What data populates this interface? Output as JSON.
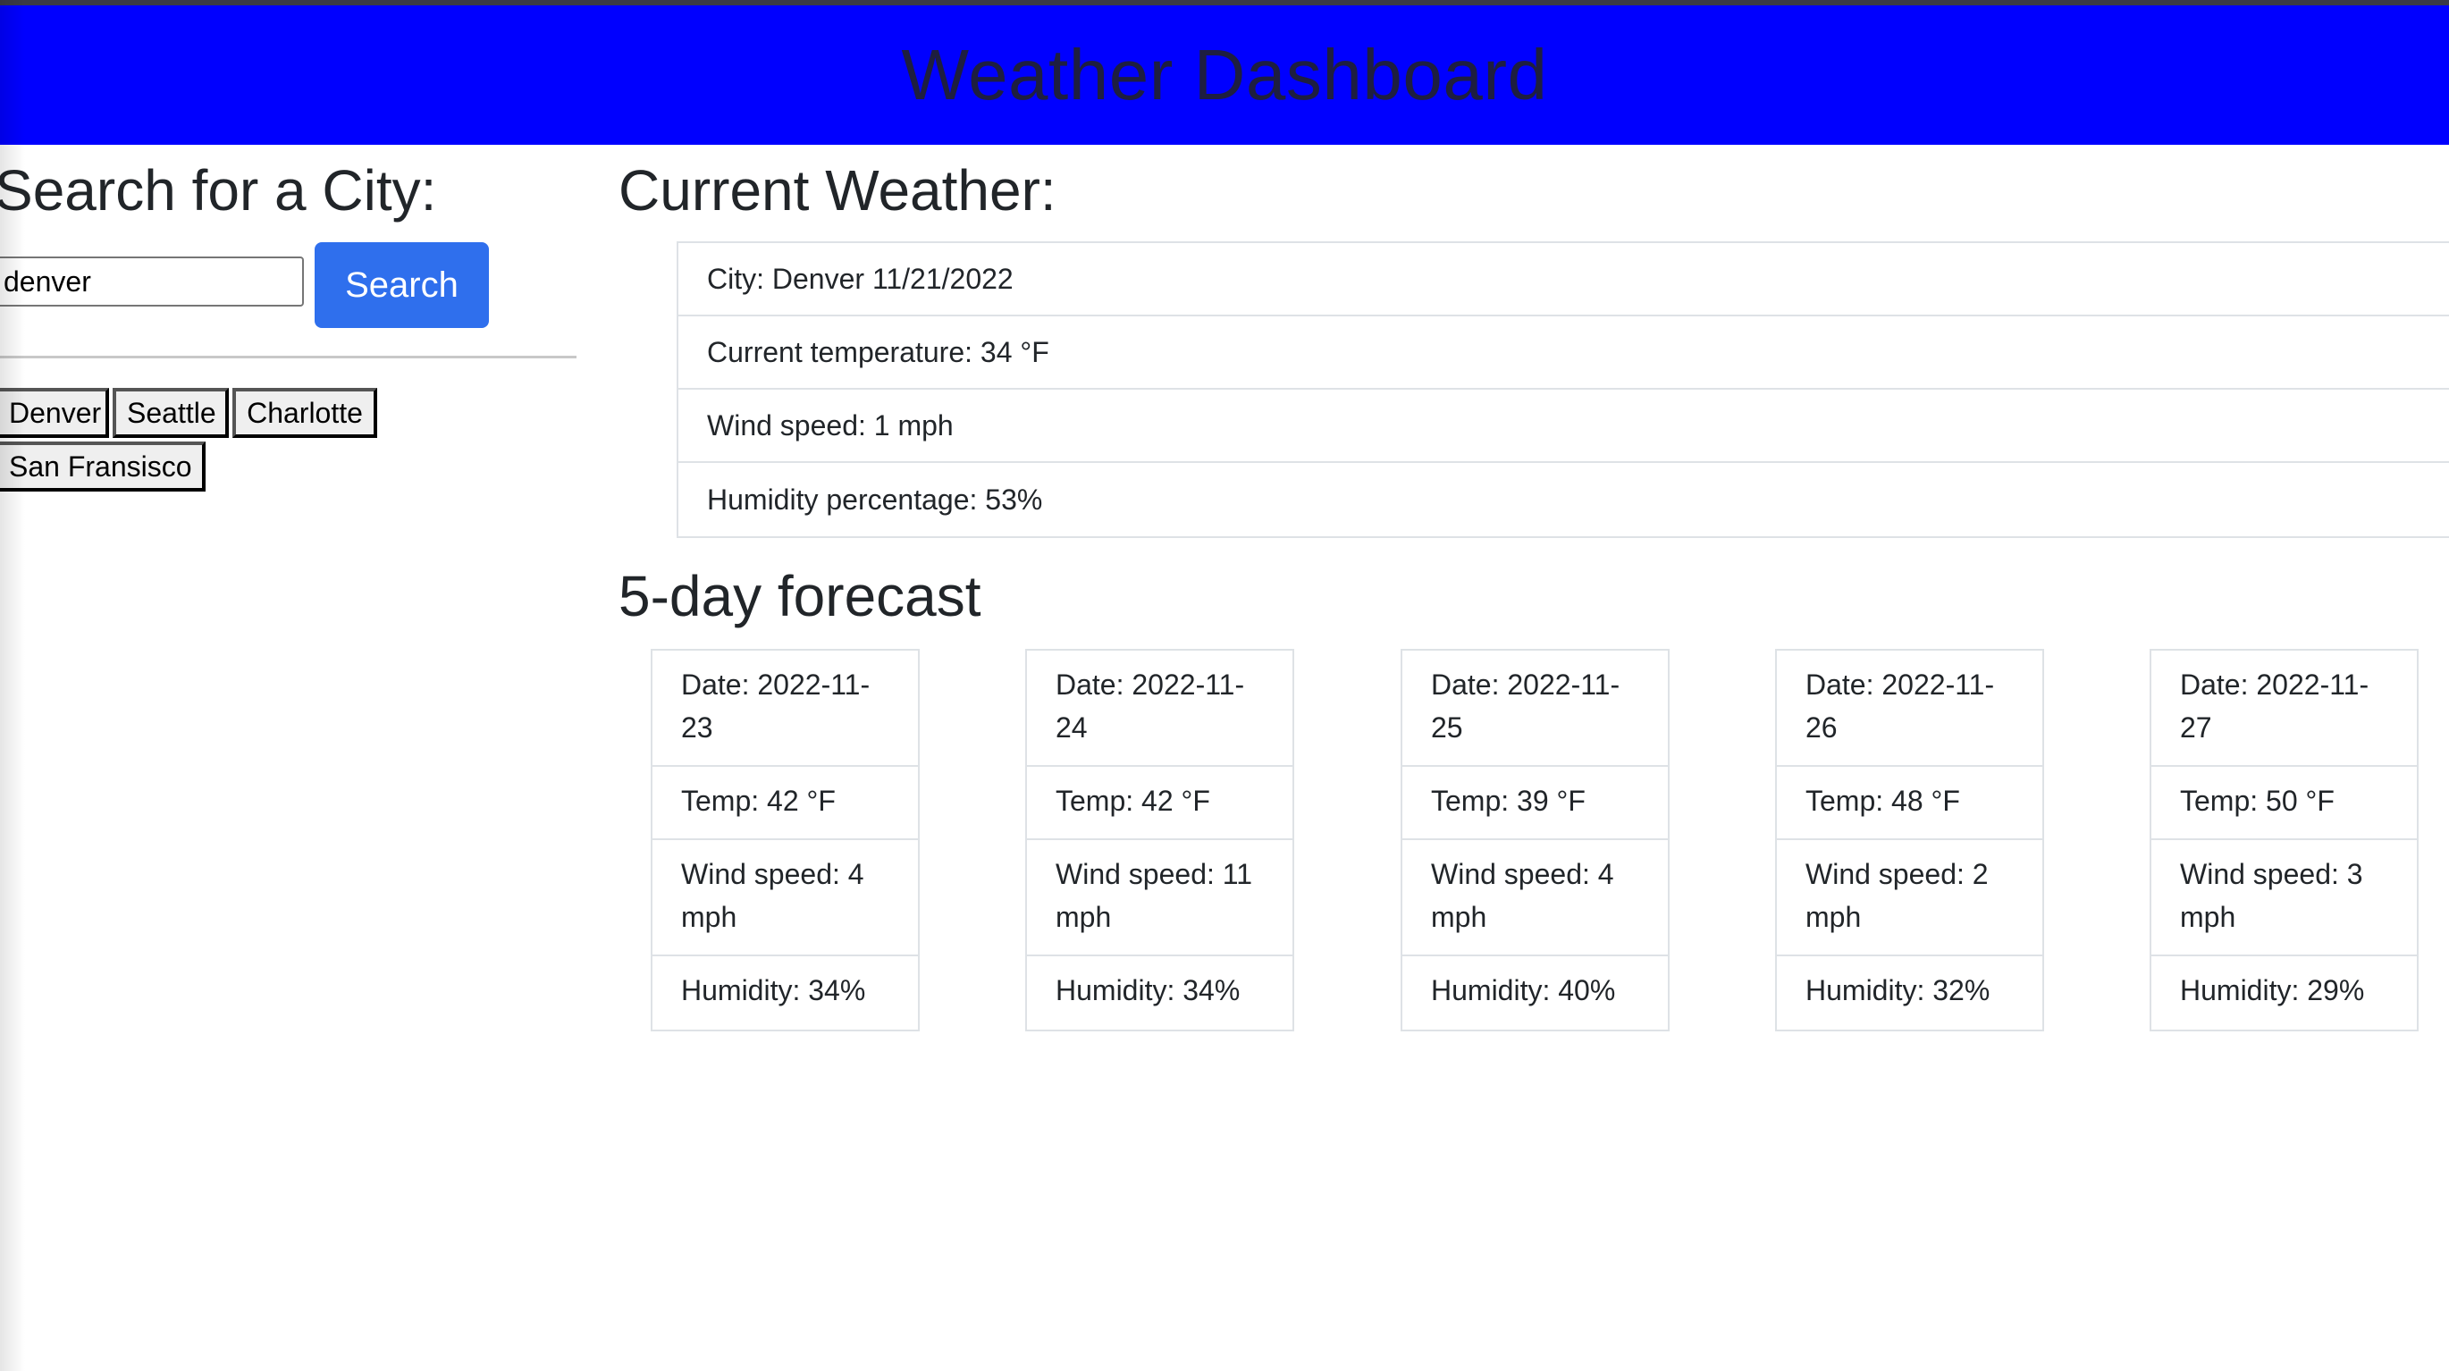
{
  "header": {
    "title": "Weather Dashboard",
    "background_color": "#0000ff"
  },
  "search": {
    "title": "Search for a City:",
    "input_value": "denver",
    "button_label": "Search",
    "button_color": "#2f6fed"
  },
  "history": {
    "cities": [
      "Denver",
      "Seattle",
      "Charlotte",
      "San Fransisco"
    ]
  },
  "current": {
    "title": "Current Weather:",
    "city_line": "City: Denver 11/21/2022",
    "temperature_line": "Current temperature: 34 °F",
    "wind_line": "Wind speed: 1 mph",
    "humidity_line": "Humidity percentage: 53%"
  },
  "forecast": {
    "title": "5-day forecast",
    "days": [
      {
        "date": "Date: 2022-11-23",
        "temp": "Temp: 42 °F",
        "wind": "Wind speed: 4 mph",
        "humidity": "Humidity: 34%"
      },
      {
        "date": "Date: 2022-11-24",
        "temp": "Temp: 42 °F",
        "wind": "Wind speed: 11 mph",
        "humidity": "Humidity: 34%"
      },
      {
        "date": "Date: 2022-11-25",
        "temp": "Temp: 39 °F",
        "wind": "Wind speed: 4 mph",
        "humidity": "Humidity: 40%"
      },
      {
        "date": "Date: 2022-11-26",
        "temp": "Temp: 48 °F",
        "wind": "Wind speed: 2 mph",
        "humidity": "Humidity: 32%"
      },
      {
        "date": "Date: 2022-11-27",
        "temp": "Temp: 50 °F",
        "wind": "Wind speed: 3 mph",
        "humidity": "Humidity: 29%"
      }
    ]
  }
}
